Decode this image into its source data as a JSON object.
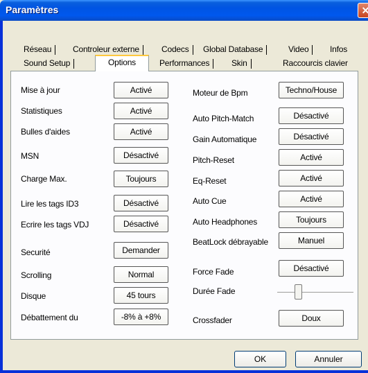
{
  "window": {
    "title": "Paramètres",
    "close_glyph": "✕"
  },
  "tabs": {
    "row1": [
      "Réseau",
      "Controleur externe",
      "Codecs",
      "Global Database",
      "Video",
      "Infos"
    ],
    "row2": [
      "Sound Setup",
      "Options",
      "Performances",
      "Skin",
      "Raccourcis clavier"
    ],
    "active": "Options"
  },
  "options": {
    "left": [
      {
        "label": "Mise à jour",
        "value": "Activé"
      },
      {
        "label": "Statistiques",
        "value": "Activé"
      },
      {
        "label": "Bulles d'aides",
        "value": "Activé"
      },
      {
        "label": "MSN",
        "value": "Désactivé"
      },
      {
        "label": "Charge Max.",
        "value": "Toujours"
      },
      {
        "label": "Lire les tags ID3",
        "value": "Désactivé"
      },
      {
        "label": "Ecrire les tags VDJ",
        "value": "Désactivé"
      },
      {
        "label": "Securité",
        "value": "Demander"
      },
      {
        "label": "Scrolling",
        "value": "Normal"
      },
      {
        "label": "Disque",
        "value": "45 tours"
      },
      {
        "label": "Débattement du",
        "value": "-8% à +8%"
      }
    ],
    "right": [
      {
        "label": "Moteur de Bpm",
        "value": "Techno/House"
      },
      {
        "label": "Auto Pitch-Match",
        "value": "Désactivé"
      },
      {
        "label": "Gain Automatique",
        "value": "Désactivé"
      },
      {
        "label": "Pitch-Reset",
        "value": "Activé"
      },
      {
        "label": "Eq-Reset",
        "value": "Activé"
      },
      {
        "label": "Auto Cue",
        "value": "Activé"
      },
      {
        "label": "Auto Headphones",
        "value": "Toujours"
      },
      {
        "label": "BeatLock débrayable",
        "value": "Manuel"
      },
      {
        "label": "Force Fade",
        "value": "Désactivé"
      },
      {
        "label": "Durée Fade",
        "value": ""
      },
      {
        "label": "Crossfader",
        "value": "Doux"
      }
    ],
    "fade_duration_slider_fraction": 0.25
  },
  "buttons": {
    "ok": "OK",
    "cancel": "Annuler"
  }
}
